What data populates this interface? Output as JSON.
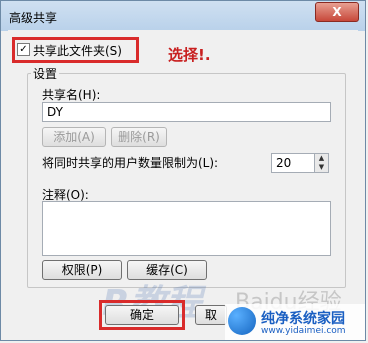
{
  "window": {
    "title": "高级共享",
    "close_glyph": "X"
  },
  "share": {
    "checkbox_mark": "✓",
    "checkbox_label": "共享此文件夹(S)",
    "annotation": "选择!."
  },
  "settings": {
    "group_title": "设置",
    "share_name_label": "共享名(H):",
    "share_name_value": "DY",
    "add_button": "添加(A)",
    "remove_button": "删除(R)",
    "limit_label": "将同时共享的用户数量限制为(L):",
    "limit_value": "20",
    "spin_up": "▲",
    "spin_down": "▼",
    "comment_label": "注释(O):",
    "comment_value": "",
    "permissions_button": "权限(P)",
    "caching_button": "缓存(C)"
  },
  "footer": {
    "ok_button": "确定",
    "cancel_button": "取"
  },
  "watermarks": {
    "big": "R教程",
    "baidu": "Baidu经验"
  },
  "site_logo": {
    "name": "纯净系统家园",
    "url": "www.yidaimei.com"
  },
  "colors": {
    "annotation_red": "#d92b2b",
    "logo_blue": "#1a5fc2"
  }
}
